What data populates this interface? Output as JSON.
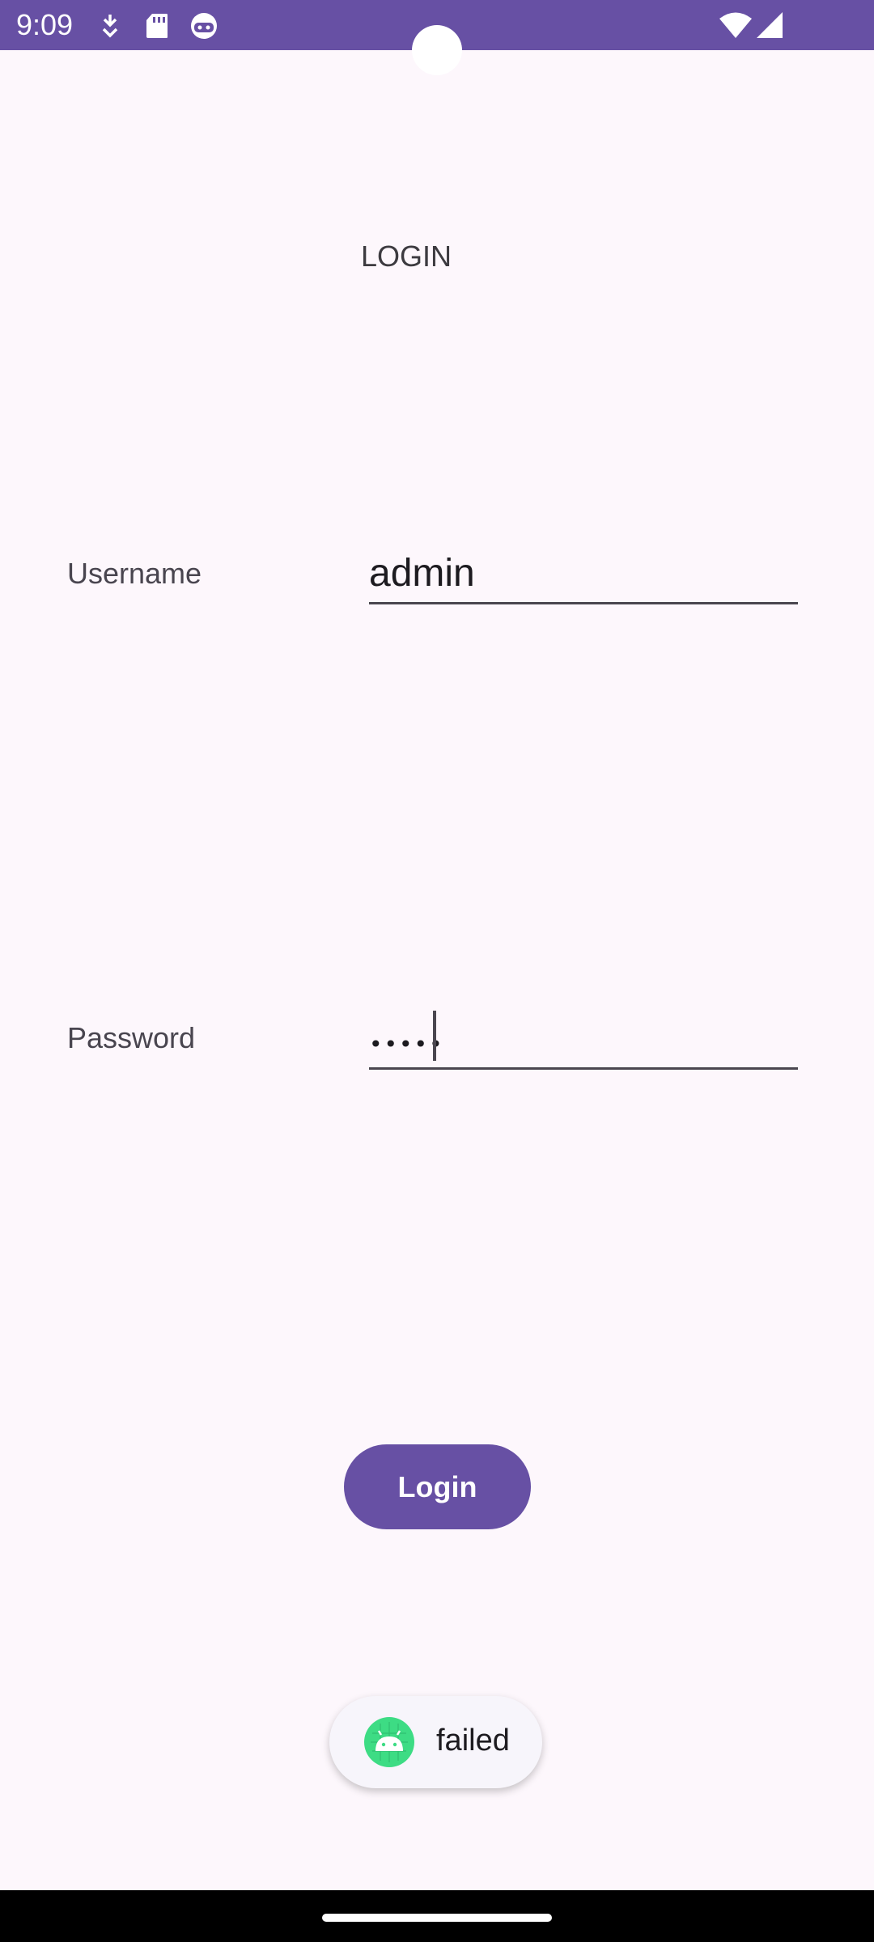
{
  "status_bar": {
    "time": "9:09",
    "icons": [
      "download-icon",
      "sd-card-icon",
      "robot-face-icon",
      "wifi-icon",
      "cell-signal-icon"
    ],
    "color": "#6750a4"
  },
  "login_screen": {
    "title": "LOGIN",
    "username_label": "Username",
    "username_value": "admin",
    "password_label": "Password",
    "password_masked": "•••••",
    "login_button": "Login"
  },
  "toast": {
    "icon": "android-app-icon",
    "message": "failed"
  },
  "colors": {
    "accent": "#6750a4",
    "background": "#fdf7fc",
    "toast_background": "#f7f5fb"
  }
}
